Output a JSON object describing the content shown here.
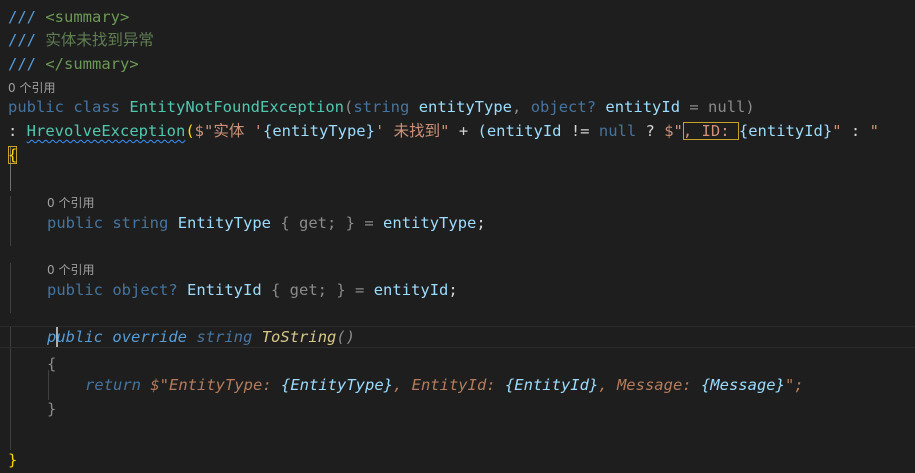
{
  "doc": {
    "summary_open_slashes": "///",
    "summary_open_tag": "<summary>",
    "summary_text": "实体未找到异常",
    "summary_close_tag": "</summary>",
    "refs_label": "0 个引用",
    "kw_public": "public",
    "kw_class": "class",
    "class_name": "EntityNotFoundException",
    "kw_string": "string",
    "param_entityType": "entityType",
    "kw_object": "object?",
    "param_entityId": "entityId",
    "default_null": "= null",
    "base_class": "HrevolveException",
    "str_part1": "$\"实体 '",
    "interp1": "{entityType}",
    "str_part2": "' 未找到\"",
    "op_plus": "+",
    "cond_open": "(entityId",
    "op_neq": "!=",
    "kw_null": "null",
    "op_q": "?",
    "str_part3": "$\"",
    "str_part4": ", ID: ",
    "interp2": "{entityId}",
    "str_part5": "\"",
    "op_colon": ":",
    "str_part6": "\"",
    "brace_open": "{",
    "brace_close": "}",
    "prop1_type": "string",
    "prop1_name": "EntityType",
    "prop1_accessor": "{ get; }",
    "prop1_init": "= entityType;",
    "prop2_type": "object?",
    "prop2_name": "EntityId",
    "prop2_accessor": "{ get; }",
    "prop2_init": "= entityId;",
    "method_kw_public_p": "p",
    "method_kw_public_rest": "ublic",
    "method_override": "override",
    "method_type": "string",
    "method_name": "ToString",
    "method_parens": "()",
    "kw_return": "return",
    "ret_str_open": "$\"EntityType: ",
    "ret_interp1": "{EntityType}",
    "ret_str_mid1": ", EntityId: ",
    "ret_interp2": "{EntityId}",
    "ret_str_mid2": ", Message: ",
    "ret_interp3": "{Message}",
    "ret_str_close": "\";"
  }
}
